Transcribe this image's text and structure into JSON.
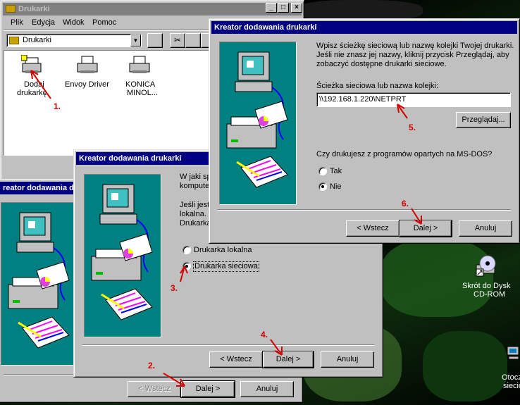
{
  "explorer": {
    "title": "Drukarki",
    "menu": [
      "Plik",
      "Edycja",
      "Widok",
      "Pomoc"
    ],
    "address": "Drukarki",
    "icons": [
      {
        "label1": "Dodaj",
        "label2": "drukarkę"
      },
      {
        "label1": "Envoy Driver",
        "label2": ""
      },
      {
        "label1": "KONICA",
        "label2": "MINOL..."
      }
    ]
  },
  "wizard_title": "Kreator dodawania drukarki",
  "wizard_back": {
    "title_partial": "reator dodawania d",
    "back": "< Wstecz",
    "next": "Dalej >",
    "cancel": "Anuluj"
  },
  "wizard_mid": {
    "intro1": "W jaki sp",
    "intro2": "kompute",
    "desc1": "Jeśli jest",
    "desc2": "lokalna. .",
    "desc3": "Drukarka",
    "opt_local": "Drukarka lokalna",
    "opt_network": "Drukarka sieciowa",
    "back": "< Wstecz",
    "next": "Dalej >",
    "cancel": "Anuluj"
  },
  "wizard_front": {
    "intro1": "Wpisz ścieżkę sieciową lub nazwę kolejki Twojej drukarki.",
    "intro2": "Jeśli nie znasz jej nazwy, kliknij przycisk Przeglądaj, aby",
    "intro3": "zobaczyć dostępne drukarki sieciowe.",
    "path_label": "Ścieżka sieciowa lub nazwa kolejki:",
    "path_value": "\\\\192.168.1.220\\NETPRT",
    "browse": "Przeglądaj...",
    "dos_question": "Czy drukujesz z programów opartych na MS-DOS?",
    "yes": "Tak",
    "no": "Nie",
    "back": "< Wstecz",
    "next": "Dalej >",
    "cancel": "Anuluj"
  },
  "desktop": {
    "cdrom_label1": "Skrót do Dysk",
    "cdrom_label2": "CD-ROM",
    "net_label1": "Otocz",
    "net_label2": "siecio"
  },
  "steps": [
    "1.",
    "2.",
    "3.",
    "4.",
    "5.",
    "6."
  ],
  "colors": {
    "titlebar_active": "#000080",
    "wizard_panel": "#008080",
    "step_marker": "#d40000"
  }
}
